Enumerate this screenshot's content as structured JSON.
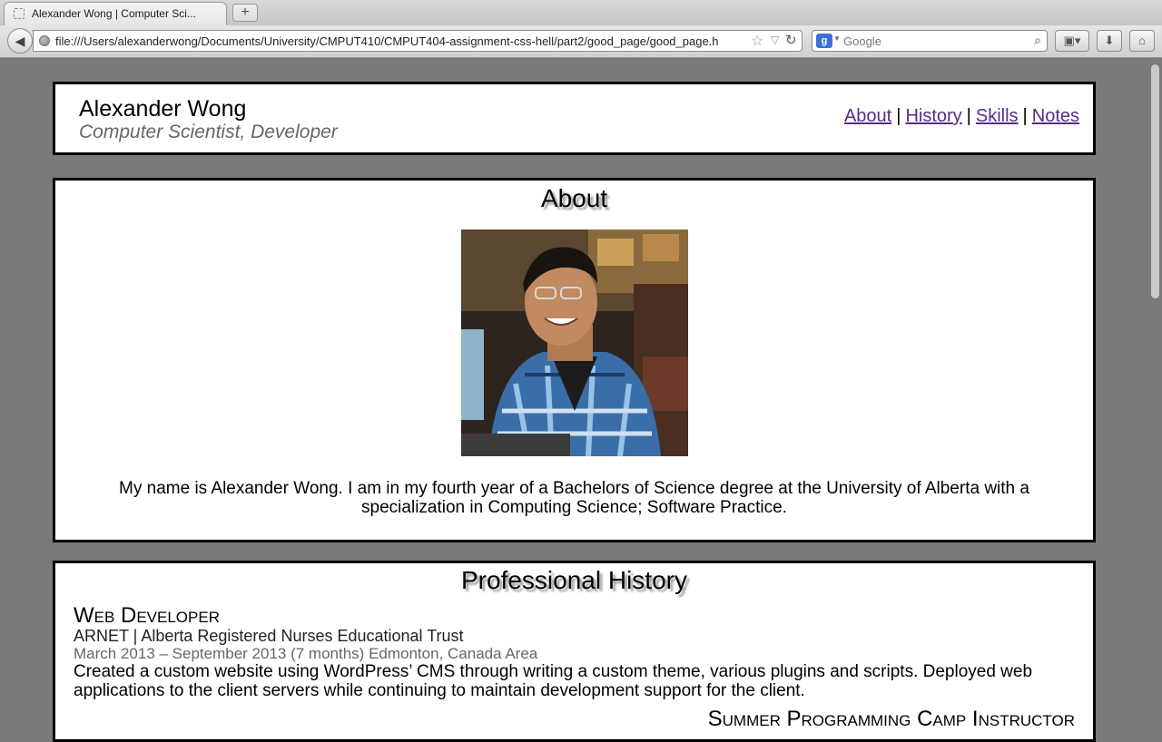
{
  "browser": {
    "tab_title": "Alexander Wong | Computer Sci...",
    "new_tab_label": "+",
    "url": "file:///Users/alexanderwong/Documents/University/CMPUT410/CMPUT404-assignment-css-hell/part2/good_page/good_page.h",
    "search_placeholder": "Google",
    "search_engine_badge": "g"
  },
  "header": {
    "name": "Alexander Wong",
    "tagline": "Computer Scientist, Developer",
    "nav": {
      "about": "About",
      "history": "History",
      "skills": "Skills",
      "notes": "Notes",
      "separator": "|"
    }
  },
  "about": {
    "title": "About",
    "text": "My name is Alexander Wong. I am in my fourth year of a Bachelors of Science degree at the University of Alberta with a specialization in Computing Science; Software Practice."
  },
  "history": {
    "title": "Professional History",
    "jobs": [
      {
        "title": "Web Developer",
        "org": "ARNET | Alberta Registered Nurses Educational Trust",
        "dates": "March 2013 – September 2013 (7 months) Edmonton, Canada Area",
        "description": "Created a custom website using WordPress’ CMS through writing a custom theme, various plugins and scripts. Deployed web applications to the client servers while continuing to maintain development support for the client."
      },
      {
        "title": "Summer Programming Camp Instructor"
      }
    ]
  }
}
